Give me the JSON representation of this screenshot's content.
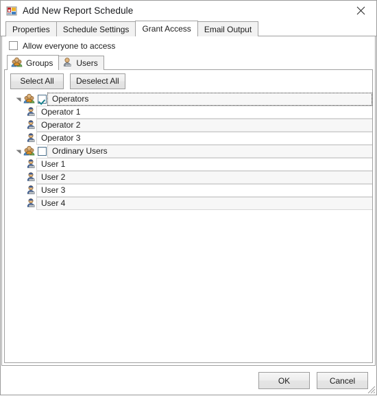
{
  "window": {
    "title": "Add New Report Schedule",
    "icon": "report-schedule-icon",
    "close_label": "✕"
  },
  "tabs": [
    {
      "label": "Properties",
      "selected": false
    },
    {
      "label": "Schedule Settings",
      "selected": false
    },
    {
      "label": "Grant Access",
      "selected": true
    },
    {
      "label": "Email Output",
      "selected": false
    }
  ],
  "grant_access": {
    "allow_everyone": {
      "label": "Allow everyone to access",
      "checked": false
    },
    "inner_tabs": [
      {
        "label": "Groups",
        "icon": "groups-icon",
        "selected": true
      },
      {
        "label": "Users",
        "icon": "user-icon",
        "selected": false
      }
    ],
    "buttons": {
      "select_all": "Select All",
      "deselect_all": "Deselect All"
    },
    "tree": [
      {
        "label": "Operators",
        "type": "group",
        "checked": true,
        "focused": true,
        "alt": true,
        "children": [
          {
            "label": "Operator 1",
            "type": "user",
            "alt": false
          },
          {
            "label": "Operator 2",
            "type": "user",
            "alt": true
          },
          {
            "label": "Operator 3",
            "type": "user",
            "alt": false
          }
        ]
      },
      {
        "label": "Ordinary Users",
        "type": "group",
        "checked": false,
        "focused": false,
        "alt": true,
        "children": [
          {
            "label": "User 1",
            "type": "user",
            "alt": false
          },
          {
            "label": "User 2",
            "type": "user",
            "alt": true
          },
          {
            "label": "User 3",
            "type": "user",
            "alt": false
          },
          {
            "label": "User 4",
            "type": "user",
            "alt": true
          }
        ]
      }
    ]
  },
  "footer": {
    "ok": "OK",
    "cancel": "Cancel"
  },
  "colors": {
    "border": "#a0a0a0",
    "window_border": "#9a9a9a",
    "button_face": "#ededed",
    "row_alt": "#f7f7f7",
    "check": "#16808c"
  }
}
